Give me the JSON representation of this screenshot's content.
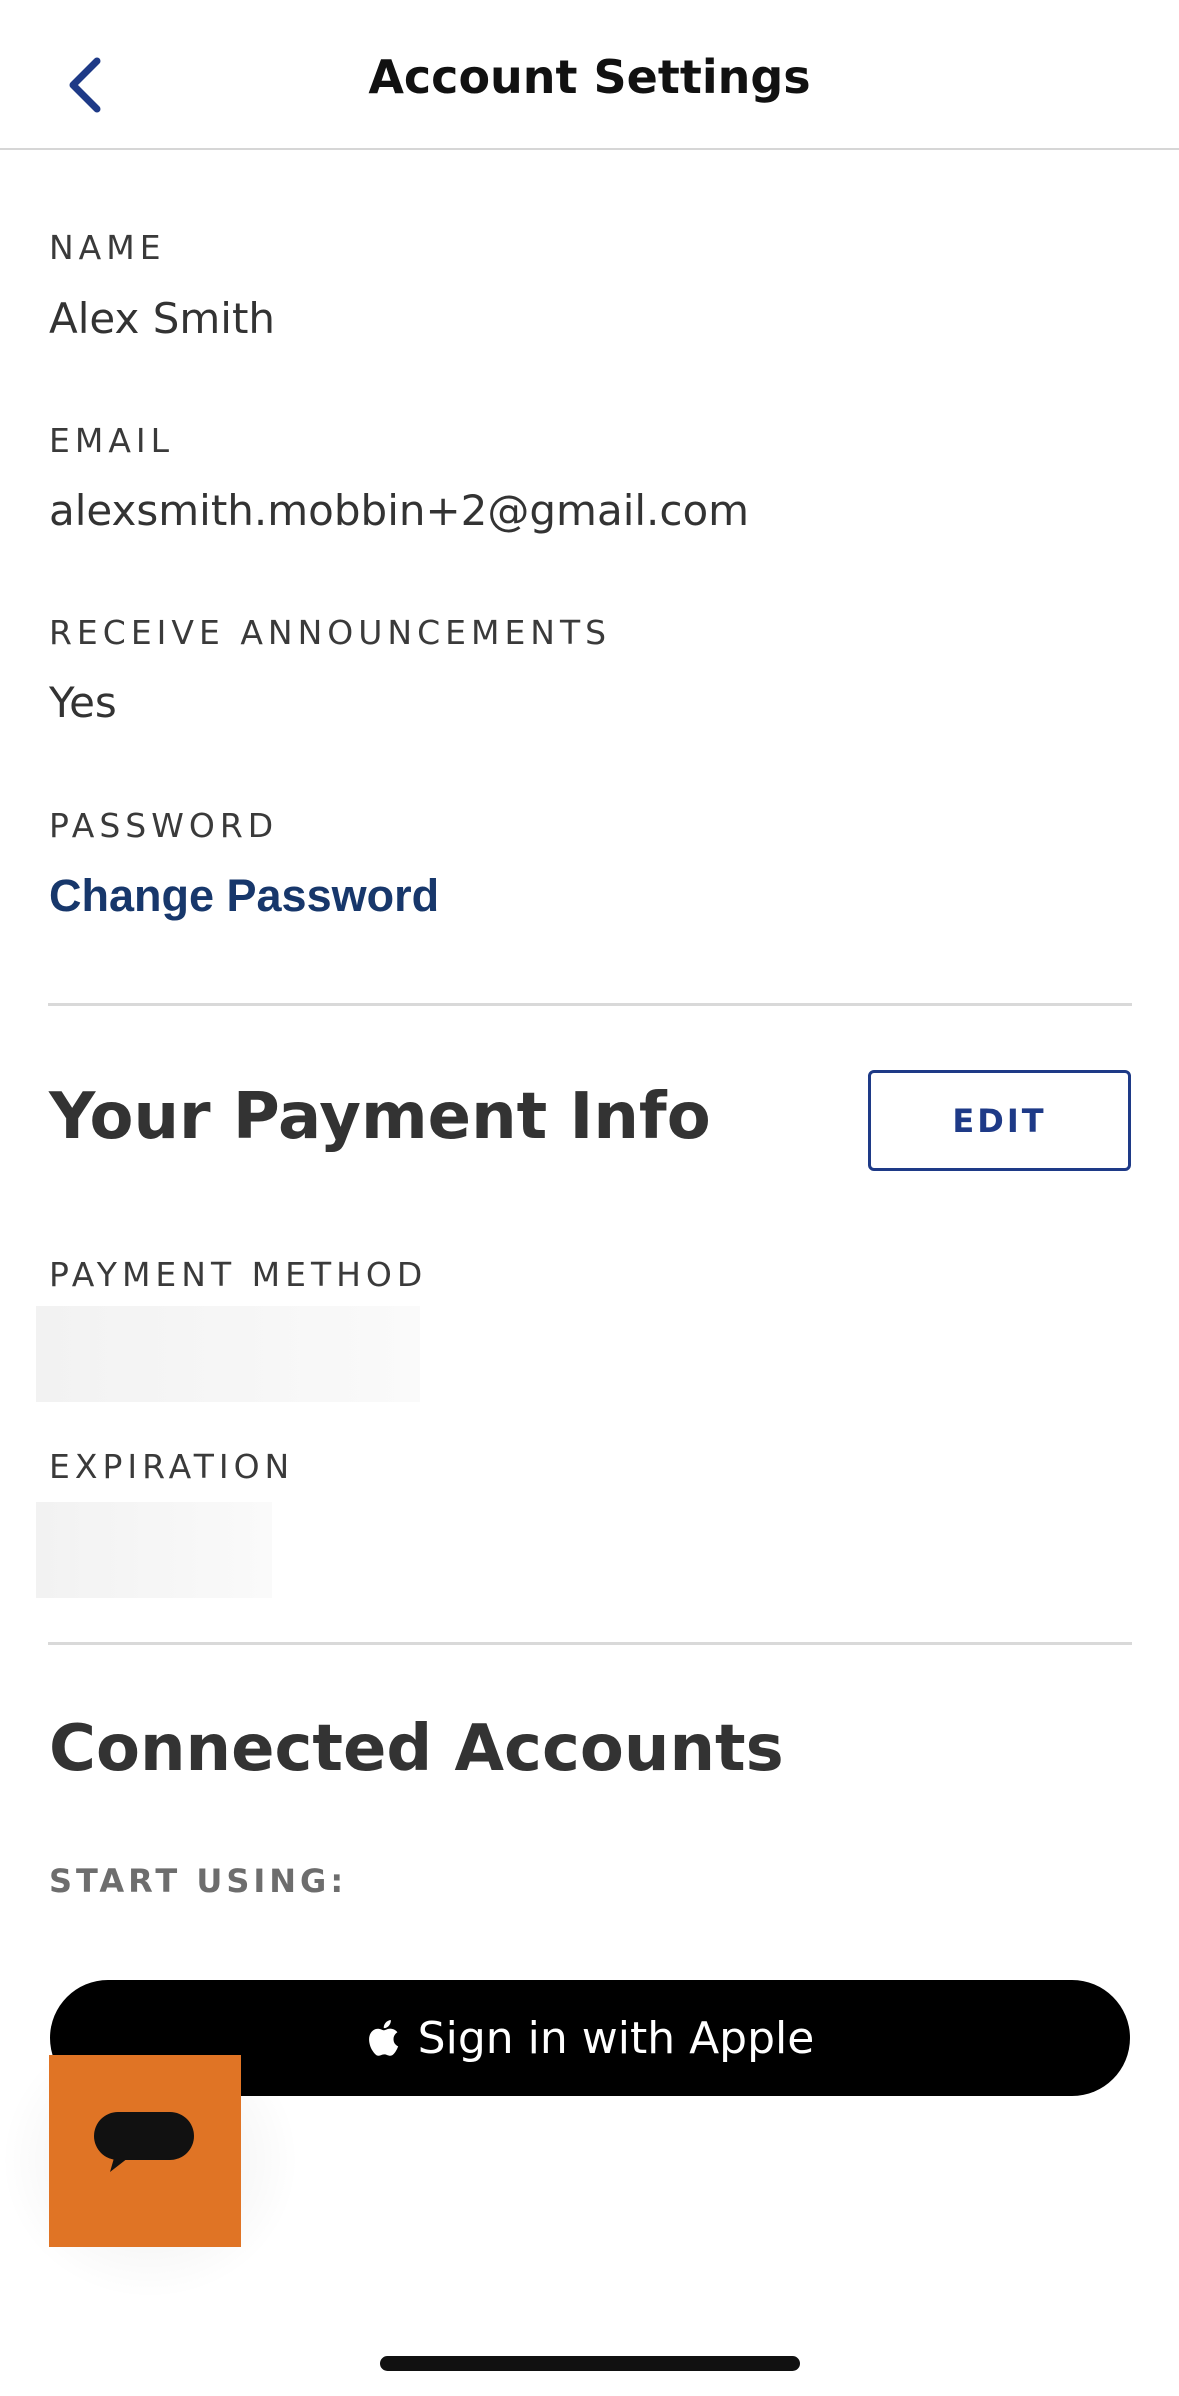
{
  "header": {
    "title": "Account Settings",
    "back_icon": "chevron-left-icon"
  },
  "account": {
    "name_label": "NAME",
    "name_value": "Alex Smith",
    "email_label": "EMAIL",
    "email_value": "alexsmith.mobbin+2@gmail.com",
    "announcements_label": "RECEIVE ANNOUNCEMENTS",
    "announcements_value": "Yes",
    "password_label": "PASSWORD",
    "change_password_link": "Change Password"
  },
  "payment": {
    "title": "Your Payment Info",
    "edit_label": "EDIT",
    "method_label": "PAYMENT METHOD",
    "expiration_label": "EXPIRATION"
  },
  "connected": {
    "title": "Connected Accounts",
    "start_using_label": "START USING:",
    "apple_button_label": "Sign in with Apple",
    "apple_icon": "apple-logo-icon"
  },
  "chat": {
    "icon": "chat-bubble-icon"
  },
  "colors": {
    "accent": "#17376b",
    "edit_border": "#1e3a87",
    "chat_fab": "#e07425",
    "apple_button": "#000000"
  }
}
